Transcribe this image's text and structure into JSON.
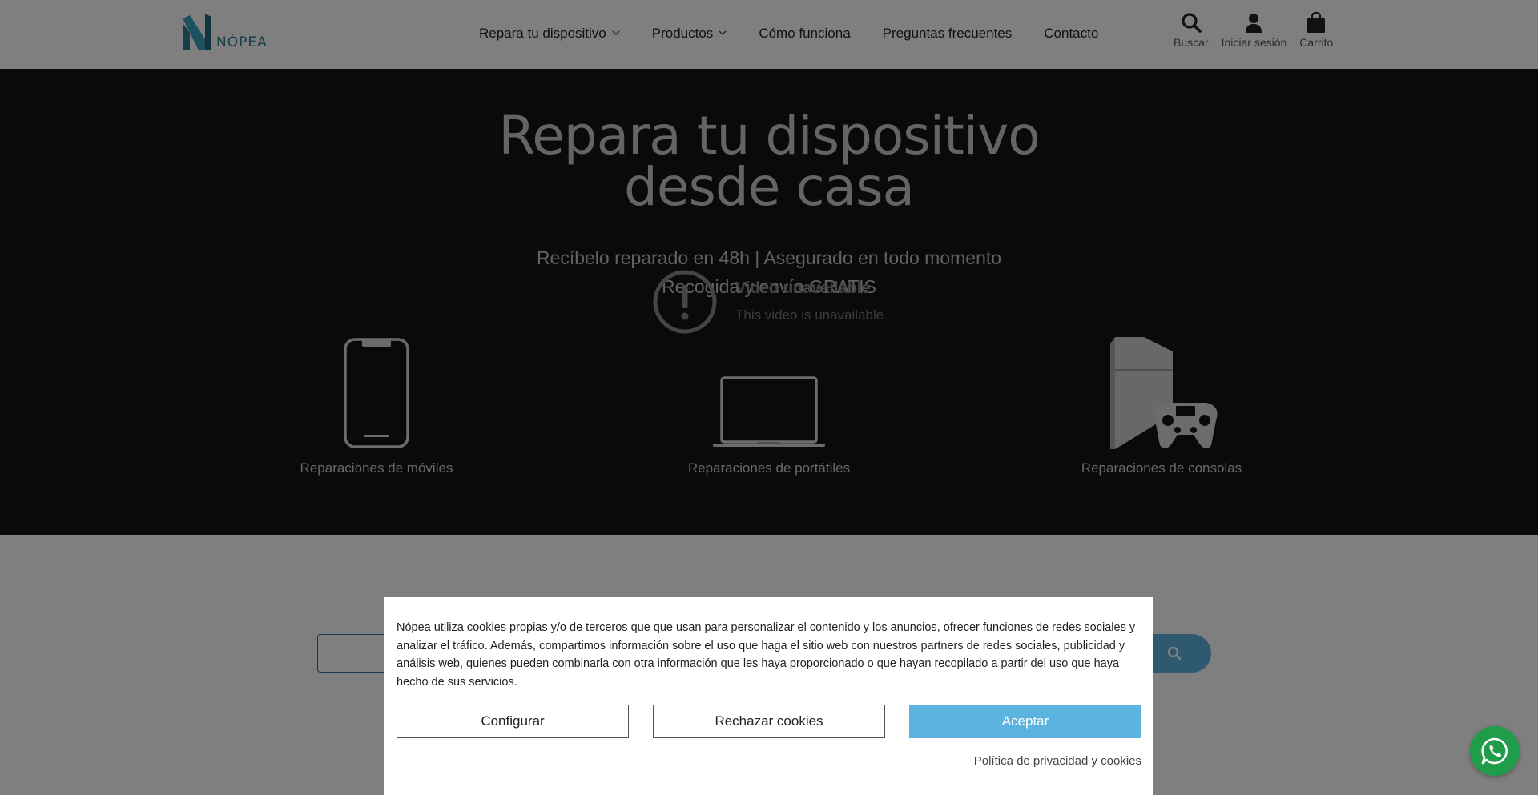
{
  "brand": {
    "name": "NÓPEA",
    "color": "#2a7a8c"
  },
  "nav": {
    "items": [
      {
        "label": "Repara tu dispositivo",
        "has_dropdown": true
      },
      {
        "label": "Productos",
        "has_dropdown": true
      },
      {
        "label": "Cómo funciona",
        "has_dropdown": false
      },
      {
        "label": "Preguntas frecuentes",
        "has_dropdown": false
      },
      {
        "label": "Contacto",
        "has_dropdown": false
      }
    ],
    "chevron": "⌄"
  },
  "header_actions": {
    "search": {
      "label": "Buscar",
      "icon": "search-icon"
    },
    "login": {
      "label": "Iniciar sesión",
      "icon": "user-icon"
    },
    "cart": {
      "label": "Carrito",
      "icon": "shopping-bag-icon"
    }
  },
  "hero": {
    "title_line1": "Repara tu dispositivo",
    "title_line2": "desde casa",
    "subtitle_line1": "Recíbelo reparado en 48h | Asegurado en todo momento",
    "subtitle_line2": "Recogida y envío GRATIS",
    "video_error": {
      "title": "Video unavailable",
      "message": "This video is unavailable",
      "icon": "exclamation-icon"
    },
    "devices": [
      {
        "label": "Reparaciones de móviles",
        "icon": "smartphone-icon"
      },
      {
        "label": "Reparaciones de portátiles",
        "icon": "laptop-icon"
      },
      {
        "label": "Reparaciones de consolas",
        "icon": "game-console-icon"
      }
    ]
  },
  "search_bar": {
    "placeholder": "",
    "icon": "search-icon"
  },
  "cookie_banner": {
    "text": "Nópea utiliza cookies propias y/o de terceros que que usan para personalizar el contenido y los anuncios, ofrecer funciones de redes sociales y analizar el tráfico. Además, compartimos información sobre el uso que haga el sitio web con nuestros partners de redes sociales, publicidad y análisis web, quienes pueden combinarla con otra información que les haya proporcionado o que hayan recopilado a partir del uso que haya hecho de sus servicios.",
    "configure_label": "Configurar",
    "reject_label": "Rechazar cookies",
    "accept_label": "Aceptar",
    "privacy_link": "Política de privacidad y cookies",
    "accent_color": "#5cb3e0"
  },
  "whatsapp": {
    "icon": "whatsapp-icon",
    "color": "#1f9d4a"
  }
}
